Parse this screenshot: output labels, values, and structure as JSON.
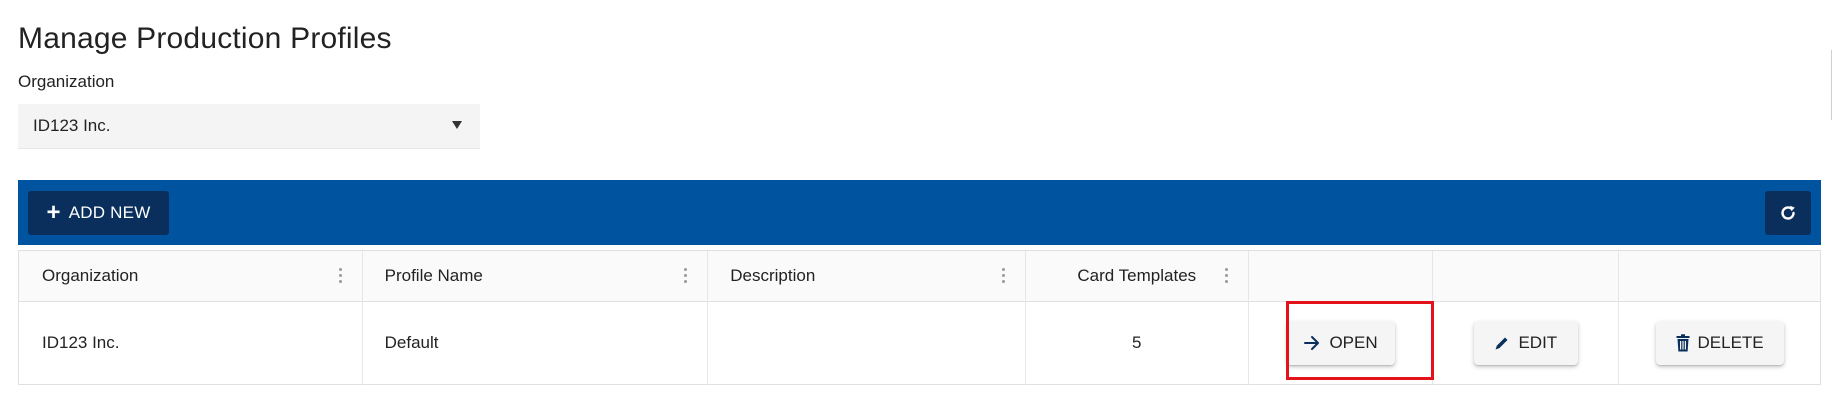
{
  "page": {
    "title": "Manage Production Profiles"
  },
  "filter": {
    "label": "Organization",
    "selected": "ID123 Inc."
  },
  "toolbar": {
    "add_label": "ADD NEW",
    "add_icon": "plus-icon",
    "refresh_icon": "refresh-icon"
  },
  "table": {
    "columns": [
      "Organization",
      "Profile Name",
      "Description",
      "Card Templates",
      "",
      "",
      ""
    ],
    "rows": [
      {
        "organization": "ID123 Inc.",
        "profile_name": "Default",
        "description": "",
        "card_templates": "5",
        "actions": {
          "open": "OPEN",
          "edit": "EDIT",
          "delete": "DELETE"
        }
      }
    ]
  },
  "colors": {
    "toolbar_bg": "#00549f",
    "button_dark": "#0a2f5c",
    "highlight": "#e3121b"
  }
}
